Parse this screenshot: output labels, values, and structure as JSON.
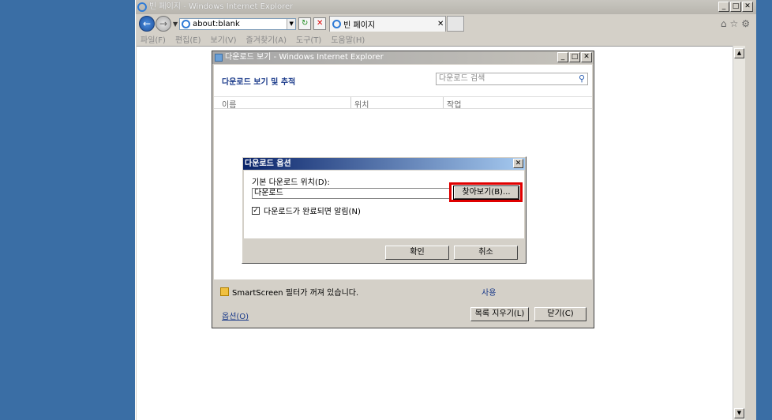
{
  "ie": {
    "title": "빈 페이지 - Windows Internet Explorer",
    "address": "about:blank",
    "tab_title": "빈 페이지",
    "menu": [
      "파일(F)",
      "편집(E)",
      "보기(V)",
      "즐겨찾기(A)",
      "도구(T)",
      "도움말(H)"
    ]
  },
  "download_manager": {
    "title": "다운로드 보기 - Windows Internet Explorer",
    "heading": "다운로드 보기 및 추적",
    "search_placeholder": "다운로드 검색",
    "columns": [
      "이름",
      "위치",
      "작업"
    ],
    "smartscreen_text": "SmartScreen 필터가 꺼져 있습니다.",
    "enable_link": "사용",
    "options_link": "옵션(O)",
    "clear_list_button": "목록 지우기(L)",
    "close_button": "닫기(C)"
  },
  "options_dialog": {
    "title": "다운로드 옵션",
    "location_label": "기본 다운로드 위치(D):",
    "location_value": "다운로드",
    "browse_button": "찾아보기(B)...",
    "notify_checkbox_label": "다운로드가 완료되면 알림(N)",
    "notify_checked": true,
    "ok_button": "확인",
    "cancel_button": "취소"
  }
}
